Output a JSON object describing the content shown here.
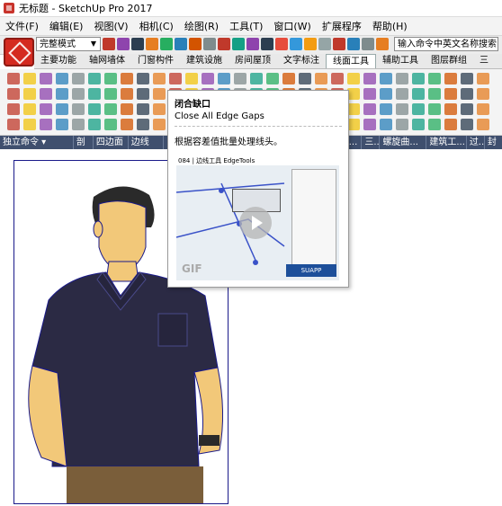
{
  "window": {
    "title": "无标题 - SketchUp Pro 2017"
  },
  "menu": [
    "文件(F)",
    "编辑(E)",
    "视图(V)",
    "相机(C)",
    "绘图(R)",
    "工具(T)",
    "窗口(W)",
    "扩展程序",
    "帮助(H)"
  ],
  "toolbar": {
    "style_select": "完整模式",
    "search_placeholder": "输入命令中英文名称搜索"
  },
  "tabs": [
    "主要功能",
    "轴网墙体",
    "门窗构件",
    "建筑设施",
    "房间屋顶",
    "文字标注",
    "线面工具",
    "辅助工具",
    "图层群组",
    "三"
  ],
  "active_tab": "线面工具",
  "groups": [
    "独立命令 ▾",
    "剖",
    "四边面",
    "边线",
    "路...",
    "三...",
    "螺旋曲...",
    "建筑工...",
    "过...",
    "封"
  ],
  "tooltip": {
    "title": "闭合缺口",
    "english": "Close All Edge Gaps",
    "description": "根据容差值批量处理线头。",
    "preview_header": "084 | 边线工具 EdgeTools",
    "preview_label": "GIF",
    "preview_brand": "SUAPP"
  },
  "colors": {
    "accent": "#3f4f6e",
    "logo": "#d42a20",
    "frame": "#1a1a8a",
    "shirt": "#2b2a44",
    "skin": "#f2c879"
  }
}
